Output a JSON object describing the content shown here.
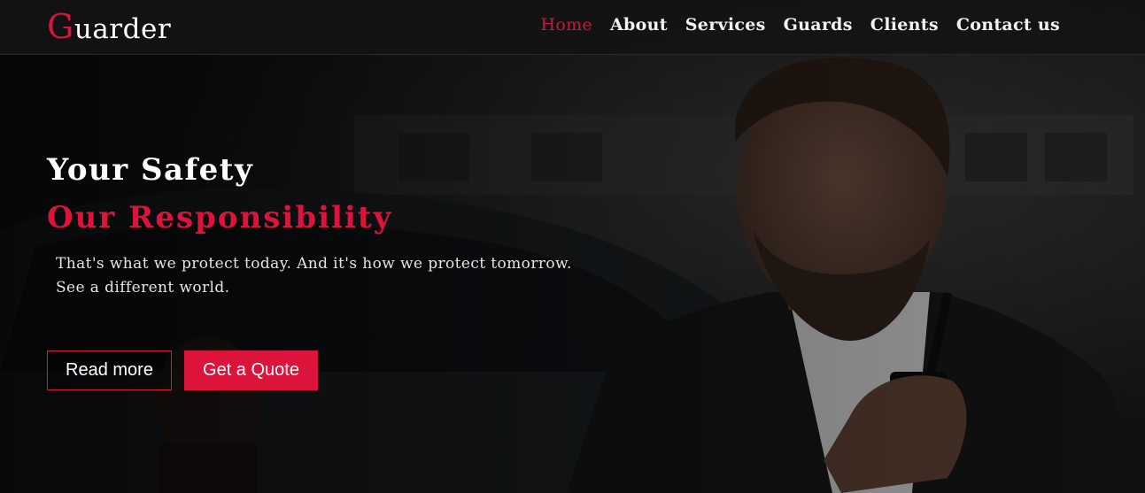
{
  "brand": {
    "first_letter": "G",
    "rest": "uarder"
  },
  "nav": {
    "items": [
      {
        "label": "Home",
        "active": true
      },
      {
        "label": "About",
        "active": false
      },
      {
        "label": "Services",
        "active": false
      },
      {
        "label": "Guards",
        "active": false
      },
      {
        "label": "Clients",
        "active": false
      },
      {
        "label": "Contact us",
        "active": false
      }
    ]
  },
  "hero": {
    "headline_line1": "Your Safety",
    "headline_line2": "Our Responsibility",
    "tagline_line1": "That's what we protect today. And it's how we protect tomorrow.",
    "tagline_line2": "See a different world.",
    "read_more_label": "Read more",
    "quote_label": "Get a Quote",
    "background_image": "security-guard-with-radio"
  },
  "colors": {
    "accent": "#dc143c",
    "header_bg": "#141414",
    "text": "#ffffff"
  }
}
